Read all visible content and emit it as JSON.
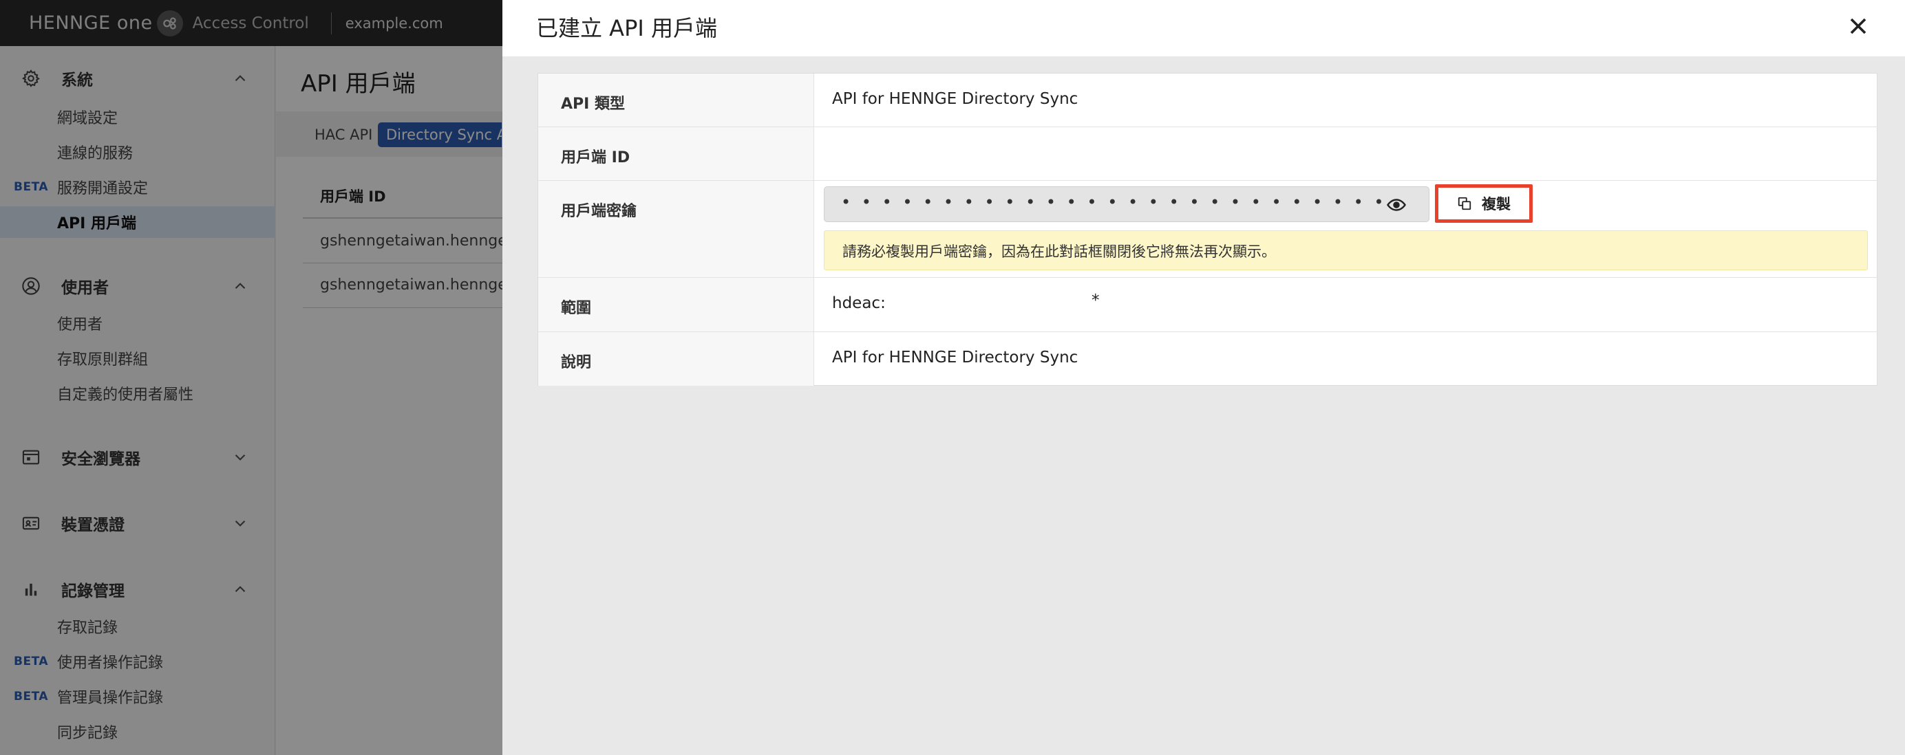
{
  "topbar": {
    "logo_text": "HENNGE one",
    "app_name": "Access Control",
    "domain": "example.com"
  },
  "sidebar": {
    "sections": [
      {
        "label": "系統",
        "icon": "gear-icon",
        "expanded": true,
        "items": [
          {
            "label": "網域設定",
            "beta": ""
          },
          {
            "label": "連線的服務",
            "beta": ""
          },
          {
            "label": "服務開通設定",
            "beta": "BETA"
          },
          {
            "label": "API 用戶端",
            "beta": "",
            "active": true
          }
        ]
      },
      {
        "label": "使用者",
        "icon": "user-circle-icon",
        "expanded": true,
        "items": [
          {
            "label": "使用者",
            "beta": ""
          },
          {
            "label": "存取原則群組",
            "beta": ""
          },
          {
            "label": "自定義的使用者屬性",
            "beta": ""
          }
        ]
      },
      {
        "label": "安全瀏覽器",
        "icon": "browser-window-icon",
        "expanded": false,
        "items": []
      },
      {
        "label": "裝置憑證",
        "icon": "id-card-icon",
        "expanded": false,
        "items": []
      },
      {
        "label": "記錄管理",
        "icon": "bar-chart-icon",
        "expanded": true,
        "items": [
          {
            "label": "存取記錄",
            "beta": ""
          },
          {
            "label": "使用者操作記錄",
            "beta": "BETA"
          },
          {
            "label": "管理員操作記錄",
            "beta": "BETA"
          },
          {
            "label": "同步記錄",
            "beta": ""
          }
        ]
      }
    ]
  },
  "main": {
    "title": "API 用戶端",
    "tabs": [
      {
        "label": "HAC API",
        "active": false
      },
      {
        "label": "Directory Sync API",
        "active": true
      }
    ],
    "table": {
      "header": "用戶端 ID",
      "rows": [
        "gshenngetaiwan.hennget",
        "gshenngetaiwan.hennget"
      ]
    }
  },
  "drawer": {
    "title": "已建立 API 用戶端",
    "fields": {
      "api_type": {
        "label": "API 類型",
        "value": "API for HENNGE Directory Sync"
      },
      "client_id": {
        "label": "用戶端 ID",
        "value": ""
      },
      "client_secret": {
        "label": "用戶端密鑰",
        "masked_value": "• • • • • • • • • • • • • • • • • • • • • • • • • • • • • • • • • • • • ...",
        "copy_label": "複製",
        "warning": "請務必複製用戶端密鑰，因為在此對話框關閉後它將無法再次顯示。"
      },
      "scope": {
        "label": "範圍",
        "value": "hdeac:",
        "value_suffix": "*"
      },
      "description": {
        "label": "說明",
        "value": "API for HENNGE Directory Sync"
      }
    }
  },
  "colors": {
    "accent": "#2c5eb3",
    "highlight_border": "#e8412c",
    "warning_bg": "#fdf6c9",
    "topbar": "#2b2b2b"
  }
}
